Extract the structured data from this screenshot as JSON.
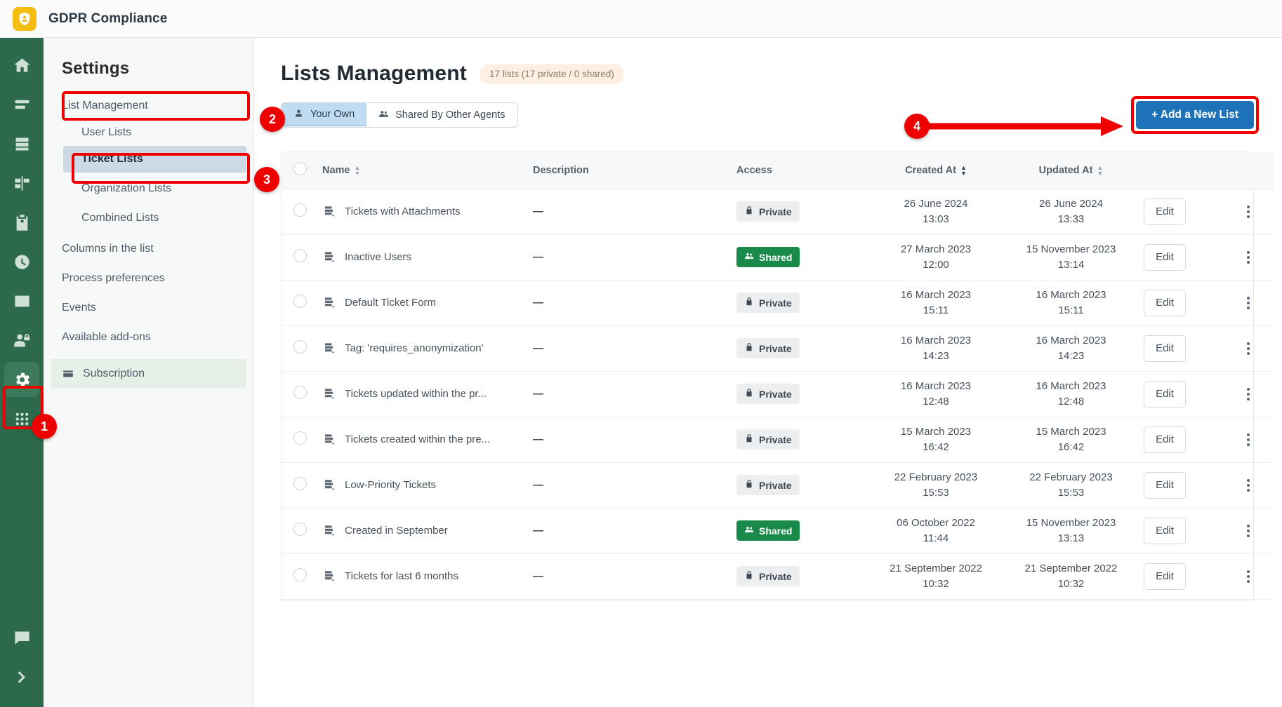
{
  "topbar": {
    "app_title": "GDPR Compliance",
    "logo_icon": "shield-user-icon"
  },
  "rail": {
    "items": [
      {
        "name": "home-icon",
        "label": "Home"
      },
      {
        "name": "list-icon",
        "label": "Lists"
      },
      {
        "name": "inbox-icon",
        "label": "Tickets"
      },
      {
        "name": "workflow-icon",
        "label": "Workflows"
      },
      {
        "name": "clipboard-user-icon",
        "label": "Contacts"
      },
      {
        "name": "clock-icon",
        "label": "History"
      },
      {
        "name": "chart-icon",
        "label": "Reports"
      },
      {
        "name": "user-lock-icon",
        "label": "Privacy"
      },
      {
        "name": "gear-icon",
        "label": "Settings"
      },
      {
        "name": "apps-grid-icon",
        "label": "Apps"
      }
    ],
    "bottom_items": [
      {
        "name": "chat-icon",
        "label": "Chat"
      },
      {
        "name": "chevron-right-icon",
        "label": "Expand"
      }
    ]
  },
  "settings": {
    "title": "Settings",
    "items": [
      {
        "label": "List Management",
        "level": "top",
        "state": "annotated"
      },
      {
        "label": "User Lists",
        "level": "sub",
        "state": "normal"
      },
      {
        "label": "Ticket Lists",
        "level": "sub",
        "state": "active"
      },
      {
        "label": "Organization Lists",
        "level": "sub",
        "state": "normal"
      },
      {
        "label": "Combined Lists",
        "level": "sub",
        "state": "normal"
      },
      {
        "label": "Columns in the list",
        "level": "top",
        "state": "normal"
      },
      {
        "label": "Process preferences",
        "level": "top",
        "state": "normal"
      },
      {
        "label": "Events",
        "level": "top",
        "state": "normal"
      },
      {
        "label": "Available add-ons",
        "level": "top",
        "state": "normal"
      },
      {
        "label": "Subscription",
        "level": "top",
        "state": "highlight",
        "icon": "card-icon"
      }
    ]
  },
  "main": {
    "page_title": "Lists Management",
    "count_badge": "17 lists (17 private / 0 shared)",
    "tabs": [
      {
        "label": "Your Own",
        "icon": "user-icon",
        "active": true
      },
      {
        "label": "Shared By Other Agents",
        "icon": "users-icon",
        "active": false
      }
    ],
    "add_button": "+ Add a New List",
    "table": {
      "headers": [
        {
          "label": "Name",
          "sortable": true,
          "sorted": false
        },
        {
          "label": "Description",
          "sortable": false,
          "sorted": false
        },
        {
          "label": "Access",
          "sortable": false,
          "sorted": false
        },
        {
          "label": "Created At",
          "sortable": true,
          "sorted": true
        },
        {
          "label": "Updated At",
          "sortable": true,
          "sorted": false
        }
      ],
      "edit_label": "Edit",
      "rows": [
        {
          "name": "Tickets with Attachments",
          "description": "—",
          "access": "Private",
          "created_date": "26 June 2024",
          "created_time": "13:03",
          "updated_date": "26 June 2024",
          "updated_time": "13:33"
        },
        {
          "name": "Inactive Users",
          "description": "—",
          "access": "Shared",
          "created_date": "27 March 2023",
          "created_time": "12:00",
          "updated_date": "15 November 2023",
          "updated_time": "13:14"
        },
        {
          "name": "Default Ticket Form",
          "description": "—",
          "access": "Private",
          "created_date": "16 March 2023",
          "created_time": "15:11",
          "updated_date": "16 March 2023",
          "updated_time": "15:11"
        },
        {
          "name": "Tag: 'requires_anonymization'",
          "description": "—",
          "access": "Private",
          "created_date": "16 March 2023",
          "created_time": "14:23",
          "updated_date": "16 March 2023",
          "updated_time": "14:23"
        },
        {
          "name": "Tickets updated within the pr...",
          "description": "—",
          "access": "Private",
          "created_date": "16 March 2023",
          "created_time": "12:48",
          "updated_date": "16 March 2023",
          "updated_time": "12:48"
        },
        {
          "name": "Tickets created within the pre...",
          "description": "—",
          "access": "Private",
          "created_date": "15 March 2023",
          "created_time": "16:42",
          "updated_date": "15 March 2023",
          "updated_time": "16:42"
        },
        {
          "name": "Low-Priority Tickets",
          "description": "—",
          "access": "Private",
          "created_date": "22 February 2023",
          "created_time": "15:53",
          "updated_date": "22 February 2023",
          "updated_time": "15:53"
        },
        {
          "name": "Created in September",
          "description": "—",
          "access": "Shared",
          "created_date": "06 October 2022",
          "created_time": "11:44",
          "updated_date": "15 November 2023",
          "updated_time": "13:13"
        },
        {
          "name": "Tickets for last 6 months",
          "description": "—",
          "access": "Private",
          "created_date": "21 September 2022",
          "created_time": "10:32",
          "updated_date": "21 September 2022",
          "updated_time": "10:32"
        }
      ]
    }
  },
  "annotations": [
    {
      "number": "1",
      "target": "settings-rail-icon"
    },
    {
      "number": "2",
      "target": "list-management-menu-item"
    },
    {
      "number": "3",
      "target": "ticket-lists-menu-item"
    },
    {
      "number": "4",
      "target": "add-a-new-list-button"
    }
  ]
}
